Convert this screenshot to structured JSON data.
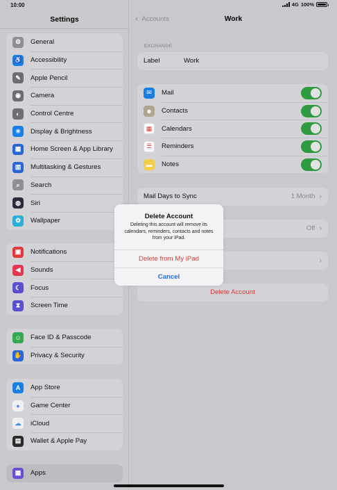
{
  "status": {
    "time": "10:00",
    "network": "4G",
    "battery": "100%"
  },
  "sidebar": {
    "title": "Settings",
    "groups": [
      [
        {
          "label": "General",
          "icon": "gear-icon",
          "color": "#8e8e93",
          "glyph": "⚙"
        },
        {
          "label": "Accessibility",
          "icon": "accessibility-icon",
          "color": "#1a7fe5",
          "glyph": "♿"
        },
        {
          "label": "Apple Pencil",
          "icon": "pencil-icon",
          "color": "#6d6d72",
          "glyph": "✎"
        },
        {
          "label": "Camera",
          "icon": "camera-icon",
          "color": "#6d6d72",
          "glyph": "◉"
        },
        {
          "label": "Control Centre",
          "icon": "control-centre-icon",
          "color": "#6d6d72",
          "glyph": "◐"
        },
        {
          "label": "Display & Brightness",
          "icon": "brightness-icon",
          "color": "#1a7fe5",
          "glyph": "☀"
        },
        {
          "label": "Home Screen & App Library",
          "icon": "home-screen-icon",
          "color": "#2a66d8",
          "glyph": "▦"
        },
        {
          "label": "Multitasking & Gestures",
          "icon": "multitasking-icon",
          "color": "#2a66d8",
          "glyph": "▥"
        },
        {
          "label": "Search",
          "icon": "search-icon",
          "color": "#8e8e93",
          "glyph": "⌕"
        },
        {
          "label": "Siri",
          "icon": "siri-icon",
          "color": "#2b2b40",
          "glyph": "◍"
        },
        {
          "label": "Wallpaper",
          "icon": "wallpaper-icon",
          "color": "#2bb0d6",
          "glyph": "✿"
        }
      ],
      [
        {
          "label": "Notifications",
          "icon": "notifications-icon",
          "color": "#e03a3a",
          "glyph": "▣"
        },
        {
          "label": "Sounds",
          "icon": "sounds-icon",
          "color": "#e0394f",
          "glyph": "◀"
        },
        {
          "label": "Focus",
          "icon": "focus-icon",
          "color": "#5a4fcf",
          "glyph": "☾"
        },
        {
          "label": "Screen Time",
          "icon": "screen-time-icon",
          "color": "#5a4fcf",
          "glyph": "⧗"
        }
      ],
      [
        {
          "label": "Face ID & Passcode",
          "icon": "face-id-icon",
          "color": "#34a853",
          "glyph": "☺"
        },
        {
          "label": "Privacy & Security",
          "icon": "privacy-hand-icon",
          "color": "#2a66d8",
          "glyph": "✋"
        }
      ],
      [
        {
          "label": "App Store",
          "icon": "app-store-icon",
          "color": "#1a7fe5",
          "glyph": "A"
        },
        {
          "label": "Game Center",
          "icon": "game-center-icon",
          "color": "#f0f0f0",
          "glyph": "●"
        },
        {
          "label": "iCloud",
          "icon": "icloud-icon",
          "color": "#f0f0f0",
          "glyph": "☁"
        },
        {
          "label": "Wallet & Apple Pay",
          "icon": "wallet-icon",
          "color": "#2b2b2b",
          "glyph": "▤"
        }
      ],
      [
        {
          "label": "Apps",
          "icon": "apps-icon",
          "color": "#6b4fd1",
          "glyph": "▦",
          "selected": true
        }
      ]
    ]
  },
  "main": {
    "back_label": "Accounts",
    "title": "Work",
    "section_header": "EXCHANGE",
    "label_row": {
      "label": "Label",
      "value": "Work"
    },
    "toggles": [
      {
        "label": "Mail",
        "icon": "mail-icon",
        "color": "#1a7fe5",
        "glyph": "✉",
        "on": true
      },
      {
        "label": "Contacts",
        "icon": "contacts-icon",
        "color": "#b0a58f",
        "glyph": "☻",
        "on": true
      },
      {
        "label": "Calendars",
        "icon": "calendars-icon",
        "color": "#ffffff",
        "glyph": "▦",
        "on": true
      },
      {
        "label": "Reminders",
        "icon": "reminders-icon",
        "color": "#ffffff",
        "glyph": "☰",
        "on": true
      },
      {
        "label": "Notes",
        "icon": "notes-icon",
        "color": "#f2cf4a",
        "glyph": "▬",
        "on": true
      }
    ],
    "mail_days": {
      "label": "Mail Days to Sync",
      "value": "1 Month"
    },
    "auto_reply": {
      "value": "Off"
    },
    "delete_account": "Delete Account"
  },
  "alert": {
    "title": "Delete Account",
    "message": "Deleting this account will remove its calendars, reminders, contacts and notes from your iPad.",
    "destructive_label": "Delete from My iPad",
    "cancel_label": "Cancel",
    "destructive_color": "#d93a32",
    "cancel_color": "#1a6fe0"
  }
}
